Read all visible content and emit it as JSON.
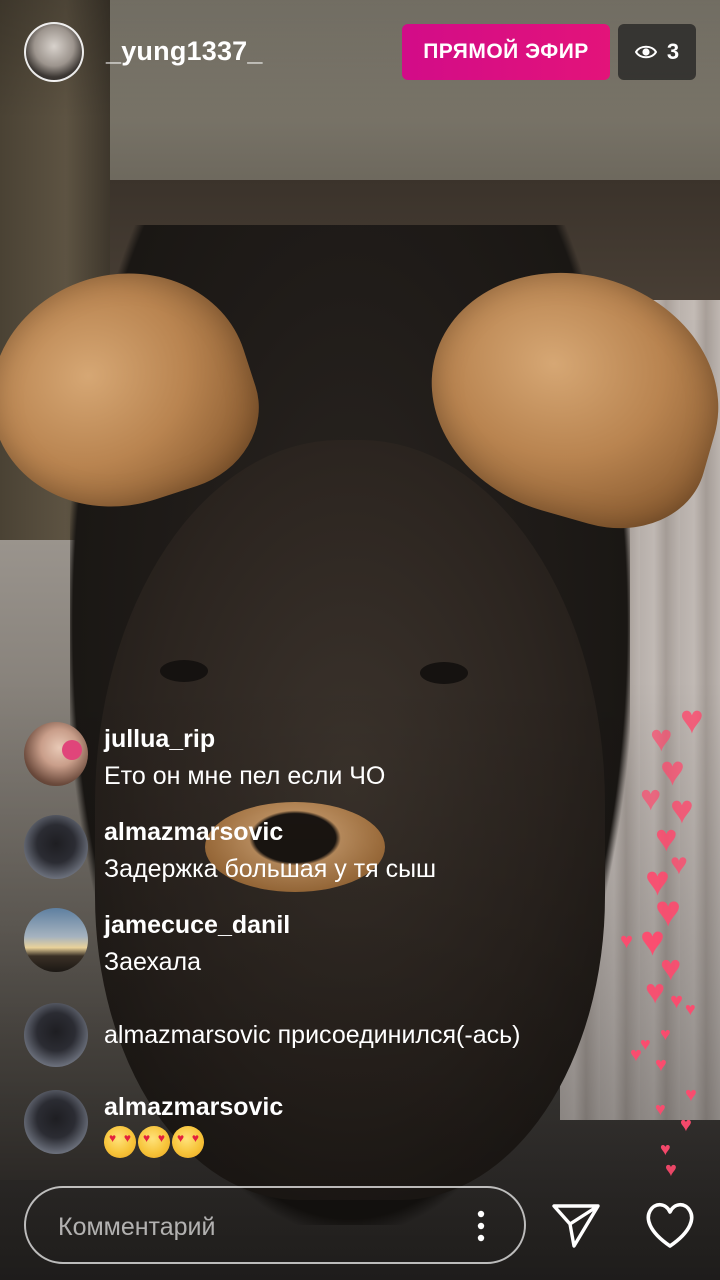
{
  "header": {
    "host_username": "_yung1337_",
    "live_label": "ПРЯМОЙ ЭФИР",
    "viewer_count": "3",
    "live_color": "#d20c88"
  },
  "comments": [
    {
      "username": "jullua_rip",
      "text": "Ето он мне пел если ЧО"
    },
    {
      "username": "almazmarsovic",
      "text": "Задержка большая у тя сыш"
    },
    {
      "username": "jamecuce_danil",
      "text": "Заехала"
    },
    {
      "system_text": "almazmarsovic присоединился(-ась)"
    },
    {
      "username": "almazmarsovic",
      "emoji": "smiling-face-with-heart-eyes",
      "emoji_count": 3
    }
  ],
  "composer": {
    "placeholder": "Комментарий",
    "icons": [
      "more-vertical-icon",
      "send-icon",
      "heart-outline-icon"
    ]
  },
  "reactions": {
    "heart_color": "#ff4a6e"
  }
}
